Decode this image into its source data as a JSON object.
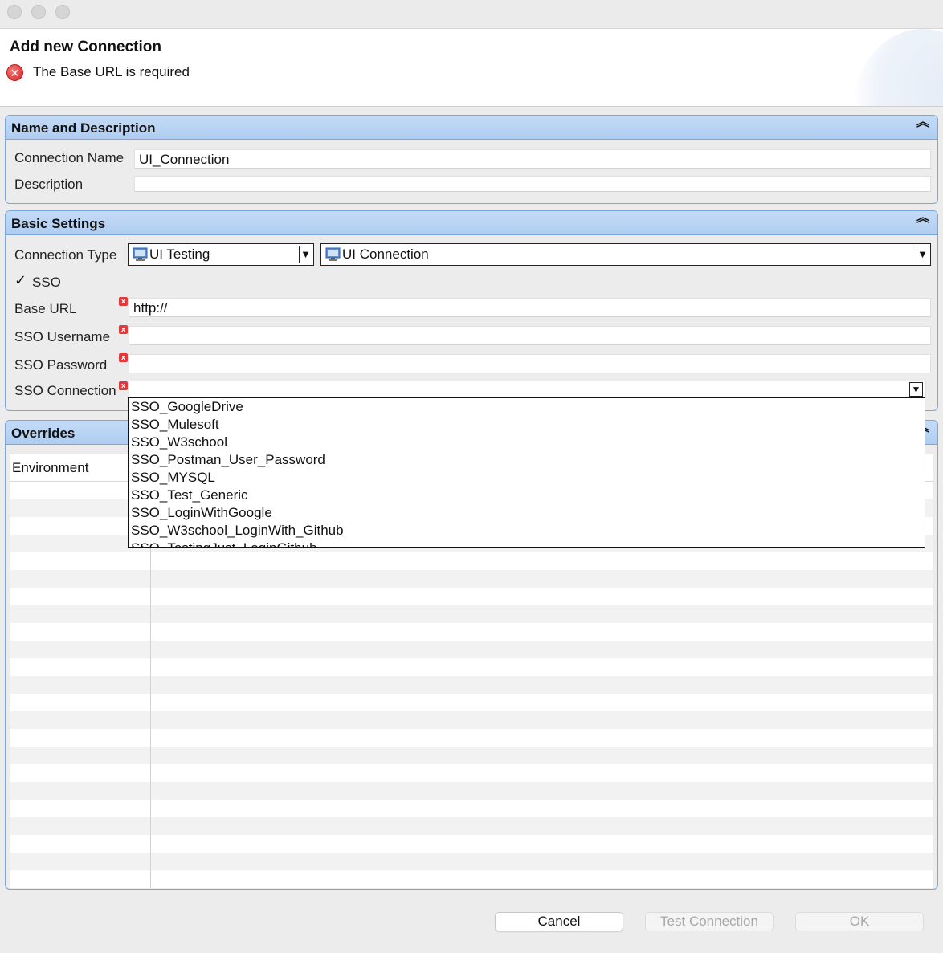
{
  "header": {
    "title": "Add new Connection",
    "error_message": "The Base URL is required"
  },
  "name_section": {
    "title": "Name and Description",
    "connection_name_label": "Connection Name",
    "connection_name_value": "UI_Connection",
    "description_label": "Description",
    "description_value": ""
  },
  "basic_section": {
    "title": "Basic Settings",
    "connection_type_label": "Connection Type",
    "connection_type_value": "UI Testing",
    "connection_subtype_value": "UI Connection",
    "sso_label": "SSO",
    "sso_checked": true,
    "base_url_label": "Base URL",
    "base_url_value": "http://",
    "sso_username_label": "SSO Username",
    "sso_username_value": "",
    "sso_password_label": "SSO Password",
    "sso_password_value": "",
    "sso_connection_label": "SSO Connection",
    "sso_connection_value": ""
  },
  "sso_dropdown": {
    "options": [
      "SSO_GoogleDrive",
      "SSO_Mulesoft",
      "SSO_W3school",
      "SSO_Postman_User_Password",
      "SSO_MYSQL",
      "SSO_Test_Generic",
      "SSO_LoginWithGoogle",
      "SSO_W3school_LoginWith_Github",
      "SSO_TestingJust_LoginGithub"
    ]
  },
  "overrides_section": {
    "title": "Overrides",
    "column_environment": "Environment"
  },
  "footer": {
    "cancel_label": "Cancel",
    "test_connection_label": "Test Connection",
    "ok_label": "OK"
  },
  "colors": {
    "section_header": "#b5d2f3",
    "section_border": "#7aa7e0",
    "error_red": "#d42525"
  }
}
